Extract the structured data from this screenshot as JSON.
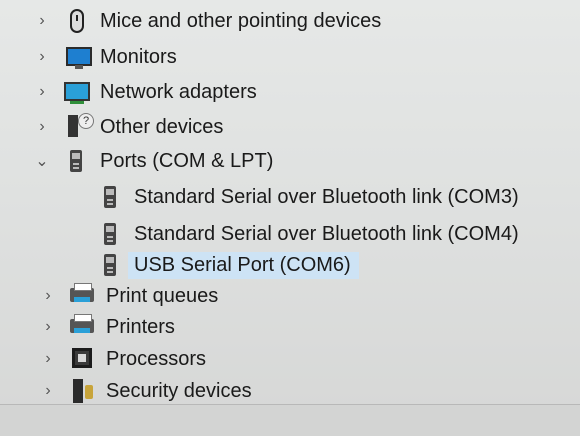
{
  "device_tree": {
    "categories": [
      {
        "label": "Mice and other pointing devices",
        "expanded": false,
        "icon": "mouse-icon"
      },
      {
        "label": "Monitors",
        "expanded": false,
        "icon": "monitor-icon"
      },
      {
        "label": "Network adapters",
        "expanded": false,
        "icon": "network-adapter-icon"
      },
      {
        "label": "Other devices",
        "expanded": false,
        "icon": "unknown-device-icon"
      },
      {
        "label": "Ports (COM & LPT)",
        "expanded": true,
        "icon": "port-icon",
        "children": [
          {
            "label": "Standard Serial over Bluetooth link (COM3)",
            "icon": "port-icon"
          },
          {
            "label": "Standard Serial over Bluetooth link (COM4)",
            "icon": "port-icon"
          },
          {
            "label": "USB Serial Port (COM6)",
            "icon": "port-icon",
            "selected": true
          }
        ]
      },
      {
        "label": "Print queues",
        "expanded": false,
        "icon": "printer-icon"
      },
      {
        "label": "Printers",
        "expanded": false,
        "icon": "printer-icon"
      },
      {
        "label": "Processors",
        "expanded": false,
        "icon": "processor-icon"
      },
      {
        "label": "Security devices",
        "expanded": false,
        "icon": "security-device-icon"
      }
    ],
    "colors": {
      "selection": "#cde3f5"
    }
  }
}
